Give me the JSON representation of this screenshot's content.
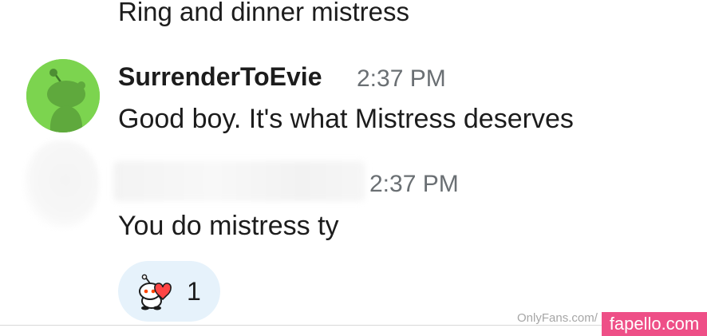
{
  "previous_message": {
    "text": "Ring and dinner mistress"
  },
  "messages": [
    {
      "username": "SurrenderToEvie",
      "timestamp": "2:37 PM",
      "text": "Good boy. It's what Mistress deserves",
      "avatar_icon": "snoo-avatar-icon",
      "avatar_color": "#7cd44f"
    },
    {
      "username": "",
      "timestamp": "2:37 PM",
      "text": "You do mistress ty",
      "avatar_icon": "blurred-avatar"
    }
  ],
  "reaction": {
    "icon": "snoo-heart-reaction-icon",
    "count": "1",
    "pill_color": "#e6f2fb"
  },
  "watermarks": {
    "onlyfans": "OnlyFans.com/",
    "fapello": "fapello.com",
    "fapello_color": "#ee4f87"
  }
}
